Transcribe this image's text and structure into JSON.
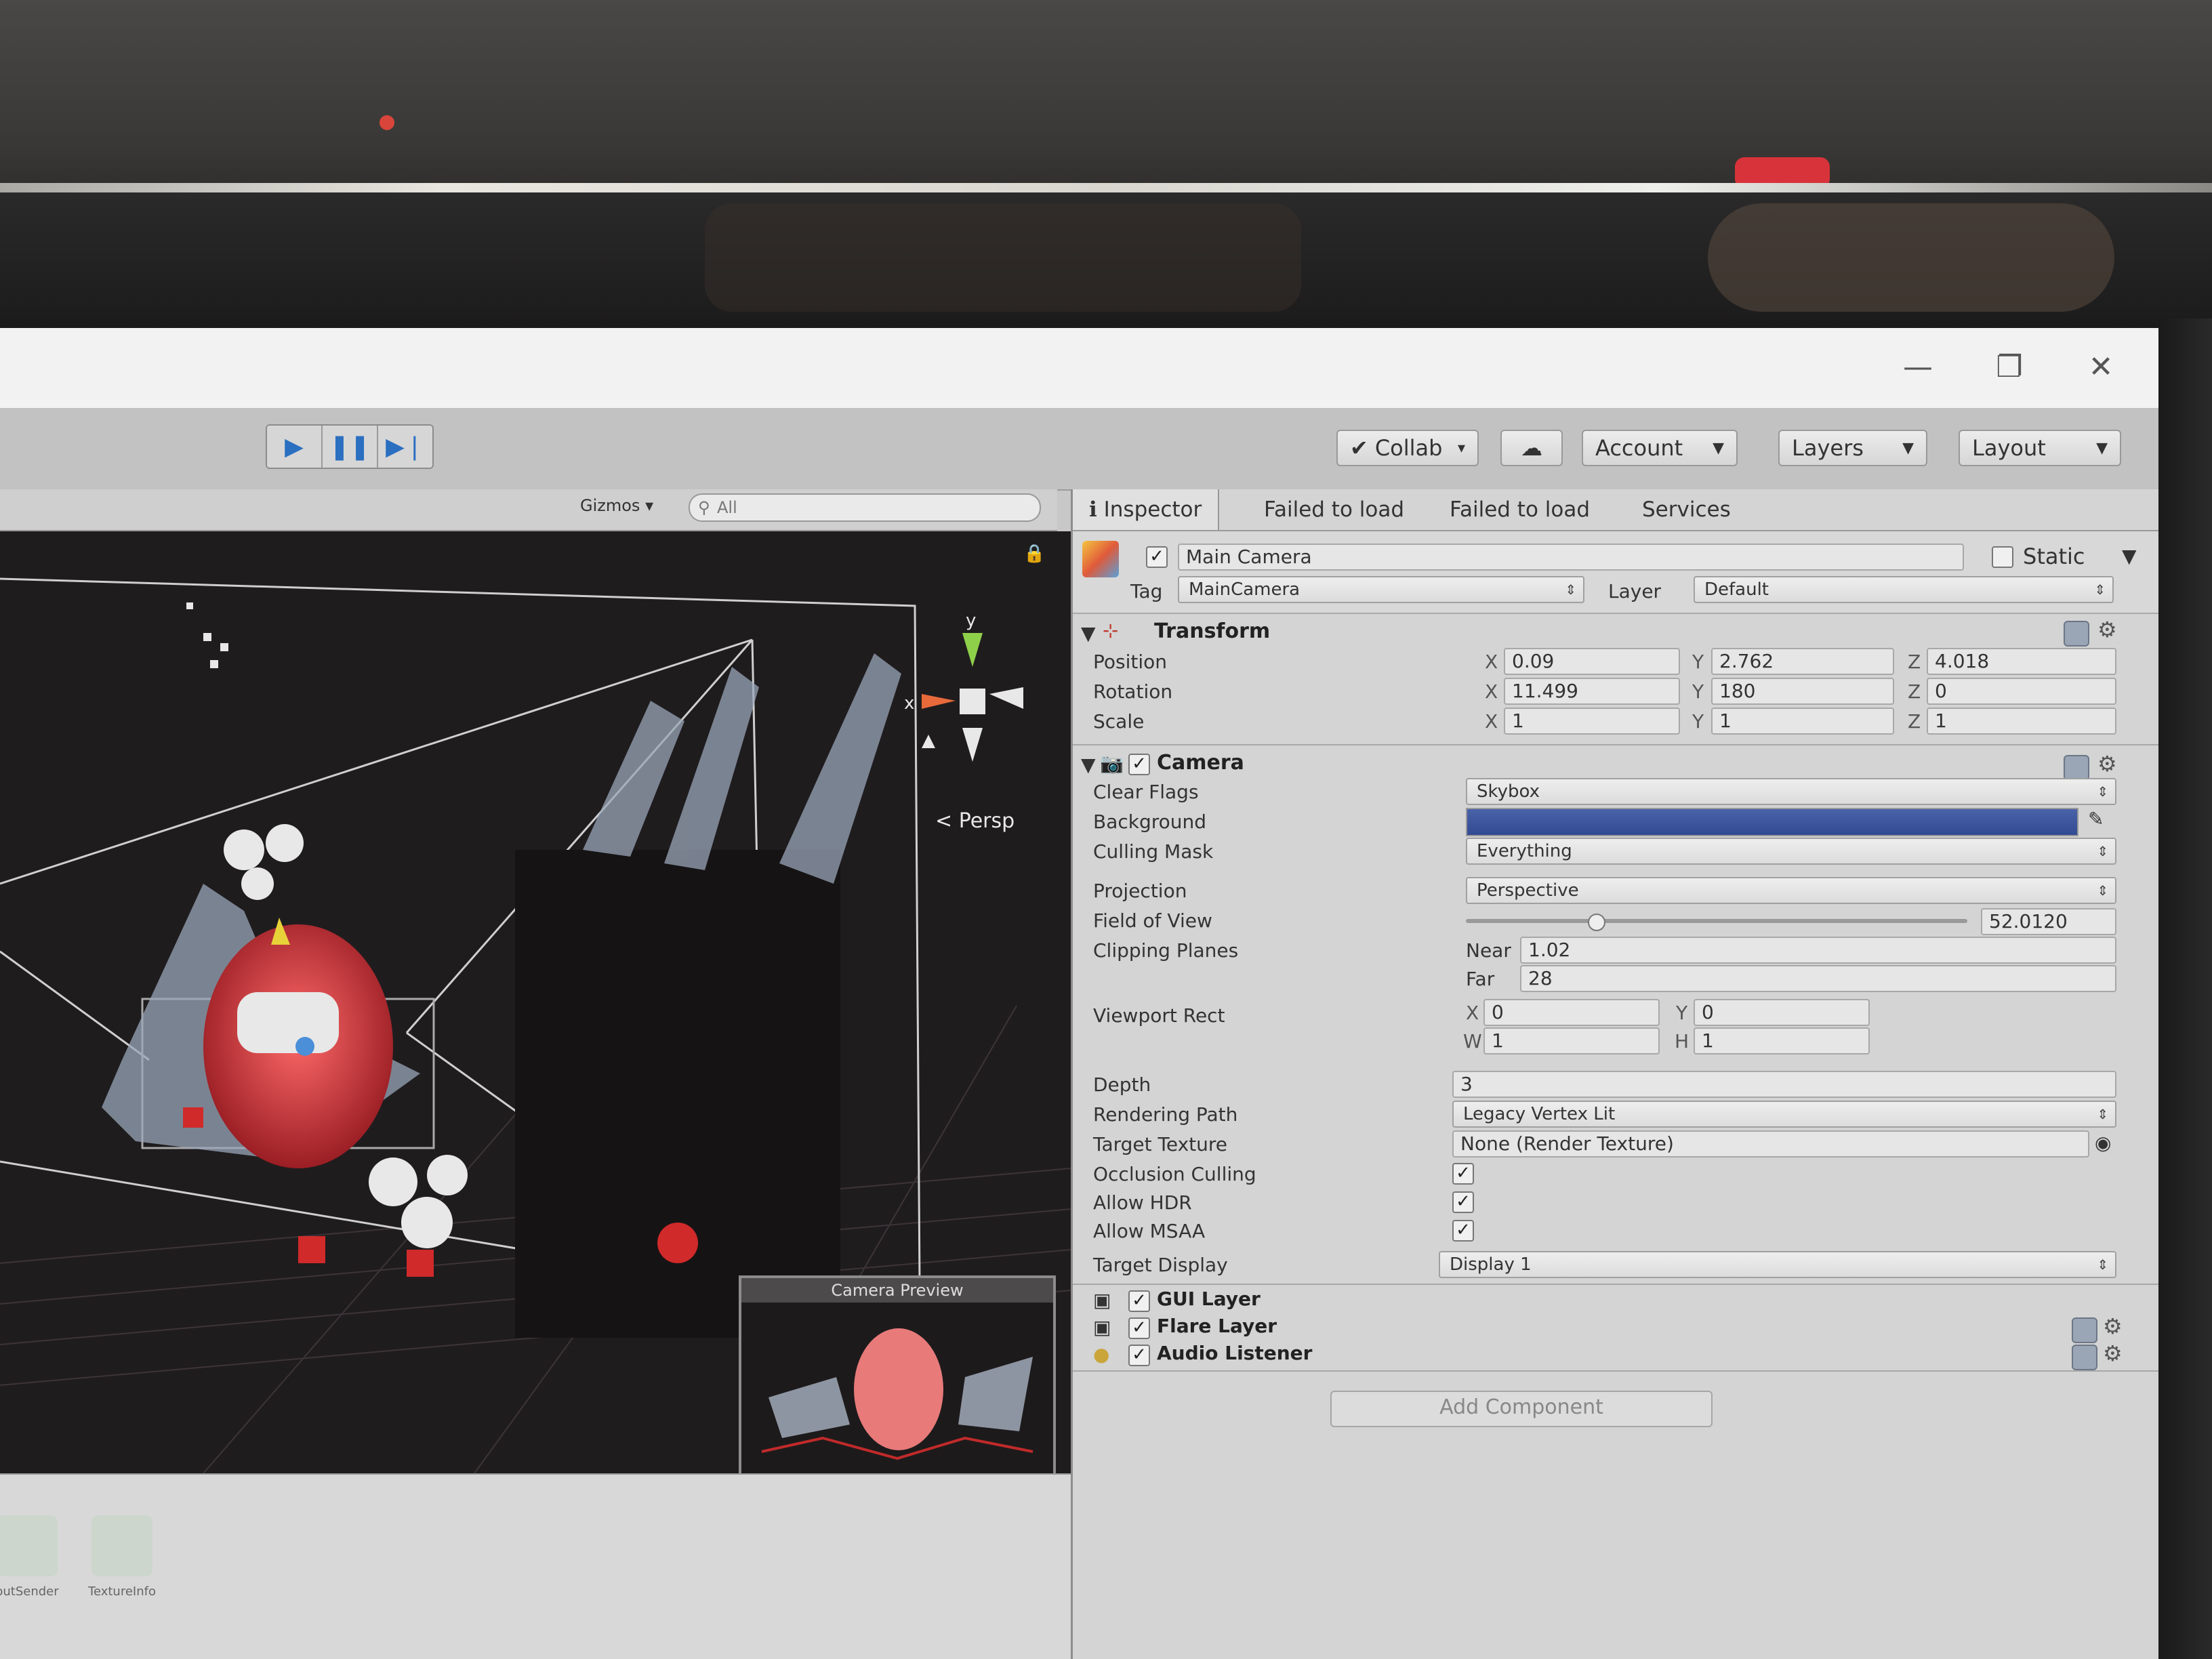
{
  "toolbar": {
    "collab_label": "Collab",
    "account_label": "Account",
    "layers_label": "Layers",
    "layout_label": "Layout"
  },
  "scene": {
    "gizmos_label": "Gizmos",
    "search_placeholder": "All",
    "persp_label": "Persp",
    "gizmo_y_label": "y",
    "gizmo_x_label": "x",
    "camera_preview_title": "Camera Preview"
  },
  "project": {
    "assets": [
      "outSender",
      "TextureInfo"
    ]
  },
  "inspector": {
    "tabs": [
      "Inspector",
      "Failed to load",
      "Failed to load",
      "Services"
    ],
    "object_name": "Main Camera",
    "static_label": "Static",
    "tag_label": "Tag",
    "tag_value": "MainCamera",
    "layer_label": "Layer",
    "layer_value": "Default",
    "transform": {
      "title": "Transform",
      "position_label": "Position",
      "rotation_label": "Rotation",
      "scale_label": "Scale",
      "position": {
        "x": "0.09",
        "y": "2.762",
        "z": "4.018"
      },
      "rotation": {
        "x": "11.499",
        "y": "180",
        "z": "0"
      },
      "scale": {
        "x": "1",
        "y": "1",
        "z": "1"
      }
    },
    "camera": {
      "title": "Camera",
      "clear_flags_label": "Clear Flags",
      "clear_flags_value": "Skybox",
      "background_label": "Background",
      "background_color": "#3a529a",
      "culling_mask_label": "Culling Mask",
      "culling_mask_value": "Everything",
      "projection_label": "Projection",
      "projection_value": "Perspective",
      "fov_label": "Field of View",
      "fov_value": "52.0120",
      "clipping_label": "Clipping Planes",
      "near_label": "Near",
      "near_value": "1.02",
      "far_label": "Far",
      "far_value": "28",
      "viewport_label": "Viewport Rect",
      "viewport": {
        "x": "0",
        "y": "0",
        "w": "1",
        "h": "1"
      },
      "depth_label": "Depth",
      "depth_value": "3",
      "rendering_path_label": "Rendering Path",
      "rendering_path_value": "Legacy Vertex Lit",
      "target_texture_label": "Target Texture",
      "target_texture_value": "None (Render Texture)",
      "occlusion_label": "Occlusion Culling",
      "hdr_label": "Allow HDR",
      "msaa_label": "Allow MSAA",
      "target_display_label": "Target Display",
      "target_display_value": "Display 1"
    },
    "components": [
      "GUI Layer",
      "Flare Layer",
      "Audio Listener"
    ],
    "add_component_label": "Add Component"
  }
}
